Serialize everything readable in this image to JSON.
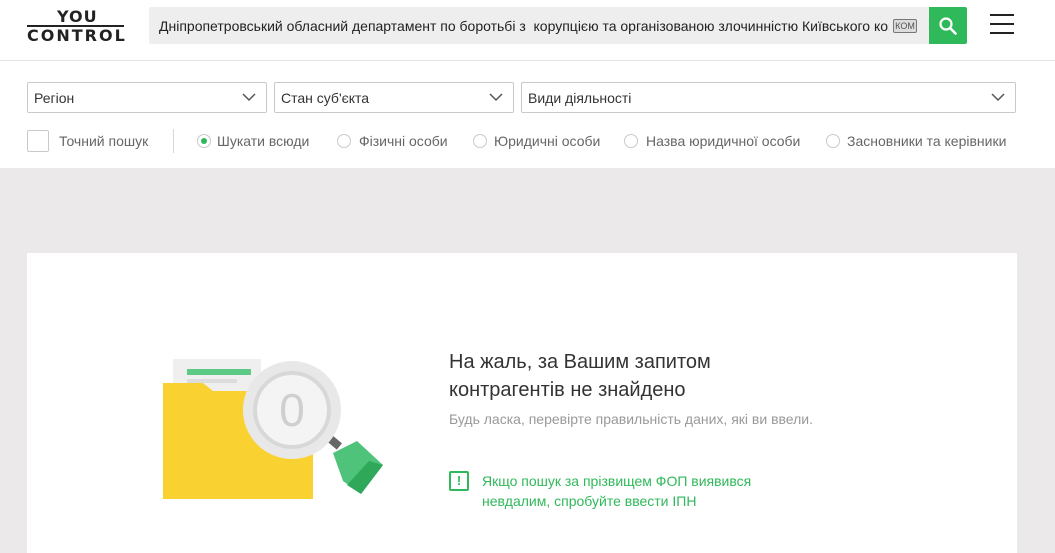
{
  "header": {
    "logo_line1": "YOU",
    "logo_line2": "CONTROL",
    "search_value": "Дніпропетровський обласний департамент по боротьбі з  корупцією та організованою злочинністю Київського ком",
    "kbd_label": "КОМ"
  },
  "filters": {
    "region_label": "Регіон",
    "state_label": "Стан суб'єкта",
    "activity_label": "Види діяльності",
    "exact_search_label": "Точний пошук",
    "radios": [
      {
        "label": "Шукати всюди",
        "selected": true
      },
      {
        "label": "Фізичні особи",
        "selected": false
      },
      {
        "label": "Юридичні особи",
        "selected": false
      },
      {
        "label": "Назва юридичної особи",
        "selected": false
      },
      {
        "label": "Засновники та керівники",
        "selected": false
      }
    ]
  },
  "result": {
    "title": "На жаль, за Вашим запитом контрагентів не знайдено",
    "subtitle": "Будь ласка, перевірте правильність даних, які ви ввели.",
    "hint_icon": "!",
    "hint_text": "Якщо пошук за прізвищем ФОП виявився невдалим, спробуйте ввести ІПН",
    "count_badge": "0"
  },
  "colors": {
    "accent": "#2fb95a",
    "folder": "#f9d232",
    "background": "#ebe9e9"
  },
  "icons": [
    "search-icon",
    "menu-icon",
    "chevron-down-icon",
    "alert-icon",
    "empty-folder-magnifier-illustration"
  ]
}
